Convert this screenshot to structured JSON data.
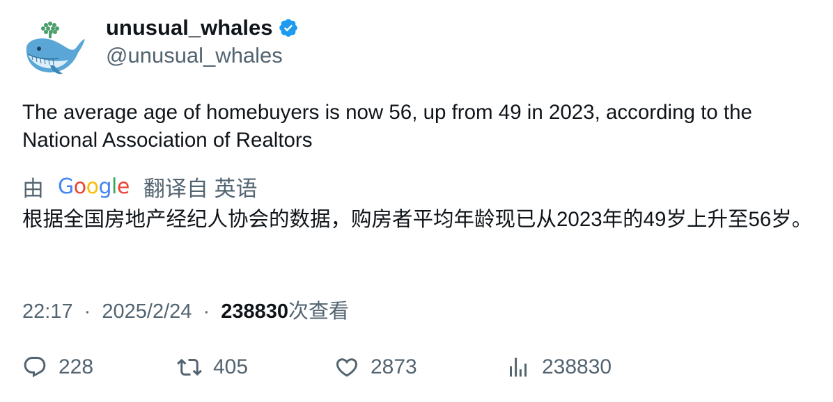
{
  "author": {
    "display_name": "unusual_whales",
    "handle": "@unusual_whales",
    "verified": true,
    "avatar_icon": "whale-icon",
    "verified_color": "#1d9bf0"
  },
  "tweet": {
    "text": "The average age of homebuyers is now 56, up from 49 in 2023, according to the National Association of Realtors"
  },
  "translation": {
    "prefix": "由",
    "provider": "Google",
    "suffix": "翻译自 英语",
    "text": "根据全国房地产经纪人协会的数据，购房者平均年龄现已从2023年的49岁上升至56岁。"
  },
  "meta": {
    "time": "22:17",
    "separator": "·",
    "date": "2025/2/24",
    "views_count": "238830",
    "views_label": "次查看"
  },
  "actions": {
    "reply": {
      "icon": "reply-icon",
      "count": "228"
    },
    "retweet": {
      "icon": "retweet-icon",
      "count": "405"
    },
    "like": {
      "icon": "heart-icon",
      "count": "2873"
    },
    "views": {
      "icon": "views-chart-icon",
      "count": "238830"
    }
  },
  "colors": {
    "text_primary": "#0f1419",
    "text_secondary": "#536471"
  }
}
